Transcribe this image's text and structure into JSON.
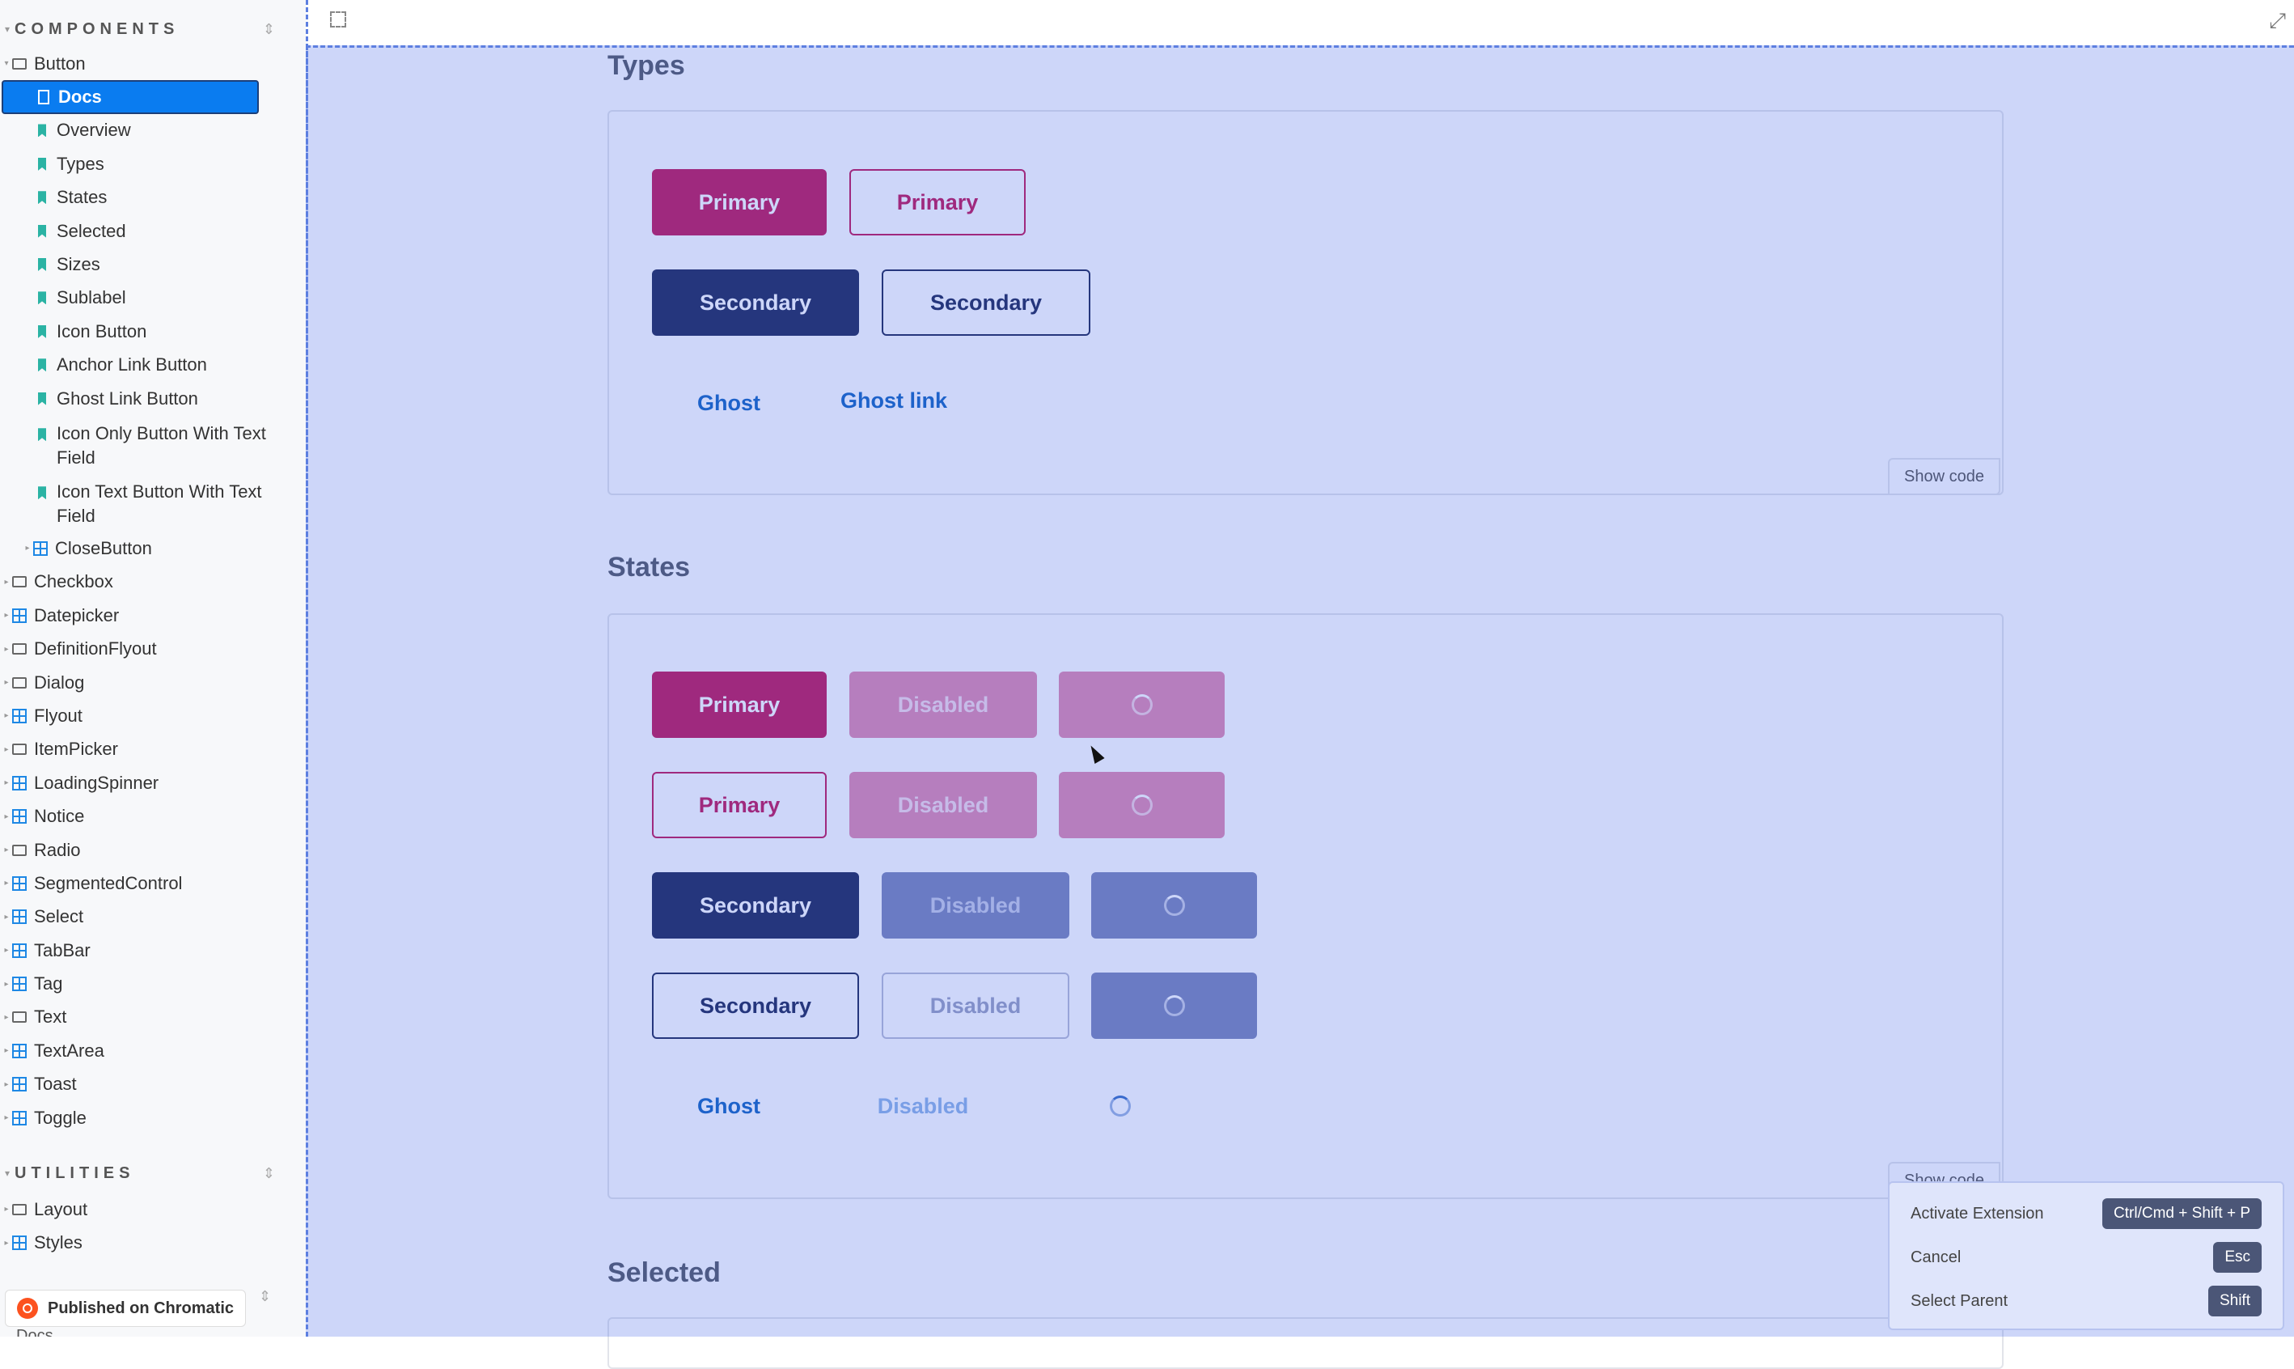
{
  "sidebar": {
    "components_title": "COMPONENTS",
    "utilities_title": "UTILITIES",
    "items": [
      {
        "label": "Button",
        "icon": "folder-icon"
      },
      {
        "label": "Docs",
        "icon": "doc-icon"
      },
      {
        "label": "Overview",
        "icon": "bookmark-icon"
      },
      {
        "label": "Types",
        "icon": "bookmark-icon"
      },
      {
        "label": "States",
        "icon": "bookmark-icon"
      },
      {
        "label": "Selected",
        "icon": "bookmark-icon"
      },
      {
        "label": "Sizes",
        "icon": "bookmark-icon"
      },
      {
        "label": "Sublabel",
        "icon": "bookmark-icon"
      },
      {
        "label": "Icon Button",
        "icon": "bookmark-icon"
      },
      {
        "label": "Anchor Link Button",
        "icon": "bookmark-icon"
      },
      {
        "label": "Ghost Link Button",
        "icon": "bookmark-icon"
      },
      {
        "label": "Icon Only Button With Text Field",
        "icon": "bookmark-icon"
      },
      {
        "label": "Icon Text Button With Text Field",
        "icon": "bookmark-icon"
      },
      {
        "label": "CloseButton",
        "icon": "grid-icon"
      },
      {
        "label": "Checkbox",
        "icon": "folder-icon"
      },
      {
        "label": "Datepicker",
        "icon": "grid-icon"
      },
      {
        "label": "DefinitionFlyout",
        "icon": "folder-icon"
      },
      {
        "label": "Dialog",
        "icon": "folder-icon"
      },
      {
        "label": "Flyout",
        "icon": "grid-icon"
      },
      {
        "label": "ItemPicker",
        "icon": "folder-icon"
      },
      {
        "label": "LoadingSpinner",
        "icon": "grid-icon"
      },
      {
        "label": "Notice",
        "icon": "grid-icon"
      },
      {
        "label": "Radio",
        "icon": "folder-icon"
      },
      {
        "label": "SegmentedControl",
        "icon": "grid-icon"
      },
      {
        "label": "Select",
        "icon": "grid-icon"
      },
      {
        "label": "TabBar",
        "icon": "grid-icon"
      },
      {
        "label": "Tag",
        "icon": "grid-icon"
      },
      {
        "label": "Text",
        "icon": "folder-icon"
      },
      {
        "label": "TextArea",
        "icon": "grid-icon"
      },
      {
        "label": "Toast",
        "icon": "grid-icon"
      },
      {
        "label": "Toggle",
        "icon": "grid-icon"
      }
    ],
    "utilities": [
      {
        "label": "Layout",
        "icon": "folder-icon"
      },
      {
        "label": "Styles",
        "icon": "grid-icon"
      }
    ],
    "chromatic_badge": "Published on Chromatic",
    "cutoff_item": "Docs"
  },
  "main": {
    "types_title": "Types",
    "states_title": "States",
    "selected_title": "Selected",
    "show_code": "Show code",
    "types": {
      "primary": "Primary",
      "primary_outline": "Primary",
      "secondary": "Secondary",
      "secondary_outline": "Secondary",
      "ghost": "Ghost",
      "ghost_link": "Ghost link"
    },
    "states": {
      "primary": "Primary",
      "disabled": "Disabled",
      "secondary": "Secondary",
      "ghost": "Ghost"
    }
  },
  "popover": {
    "rows": [
      {
        "label": "Activate Extension",
        "key": "Ctrl/Cmd + Shift + P"
      },
      {
        "label": "Cancel",
        "key": "Esc"
      },
      {
        "label": "Select Parent",
        "key": "Shift"
      }
    ]
  },
  "colors": {
    "primary": "#c2185b",
    "secondary": "#1f2a5a",
    "ghost": "#1565c0",
    "selection": "#0a7cf0",
    "overlay": "#385ce6"
  }
}
